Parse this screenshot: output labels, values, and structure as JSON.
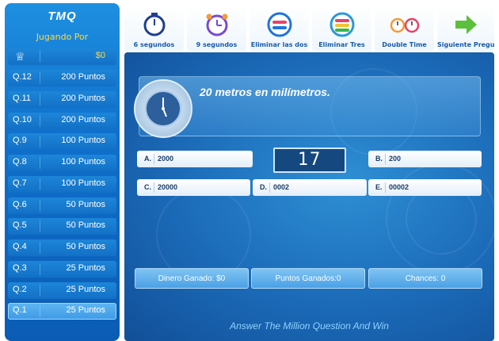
{
  "sidebar": {
    "title": "TMQ",
    "subtitle": "Jugando Por",
    "top_value": "$0",
    "levels": [
      {
        "label": "Q.12",
        "points": "200 Puntos"
      },
      {
        "label": "Q.11",
        "points": "200 Puntos"
      },
      {
        "label": "Q.10",
        "points": "200 Puntos"
      },
      {
        "label": "Q.9",
        "points": "100 Puntos"
      },
      {
        "label": "Q.8",
        "points": "100 Puntos"
      },
      {
        "label": "Q.7",
        "points": "100 Puntos"
      },
      {
        "label": "Q.6",
        "points": "50 Puntos"
      },
      {
        "label": "Q.5",
        "points": "50 Puntos"
      },
      {
        "label": "Q.4",
        "points": "50 Puntos"
      },
      {
        "label": "Q.3",
        "points": "25 Puntos"
      },
      {
        "label": "Q.2",
        "points": "25 Puntos"
      },
      {
        "label": "Q.1",
        "points": "25 Puntos"
      }
    ],
    "active_level": "Q.1"
  },
  "toolbar": [
    {
      "label": "6 segundos",
      "icon": "blue-clock-icon"
    },
    {
      "label": "9 segundos",
      "icon": "alarm-clock-icon"
    },
    {
      "label": "Eliminar las dos",
      "icon": "two-bars-icon"
    },
    {
      "label": "Eliminar Tres",
      "icon": "three-bars-icon"
    },
    {
      "label": "Double Time",
      "icon": "double-clock-icon"
    },
    {
      "label": "Siguiente Pregunta",
      "icon": "green-arrow-icon"
    }
  ],
  "question": {
    "text": "20 metros en milímetros."
  },
  "timer": "17",
  "answers": {
    "a": {
      "key": "A.",
      "value": "2000"
    },
    "b": {
      "key": "B.",
      "value": "200"
    },
    "c": {
      "key": "C.",
      "value": "20000"
    },
    "d": {
      "key": "D.",
      "value": "0002"
    },
    "e": {
      "key": "E.",
      "value": "00002"
    }
  },
  "stats": {
    "money": "Dinero Ganado: $0",
    "points": "Puntos Ganados:0",
    "chances": "Chances: 0"
  },
  "footer": "Answer The Million Question And Win",
  "colors": {
    "accent": "#ffd93a",
    "panel": "#1b6ab8"
  }
}
